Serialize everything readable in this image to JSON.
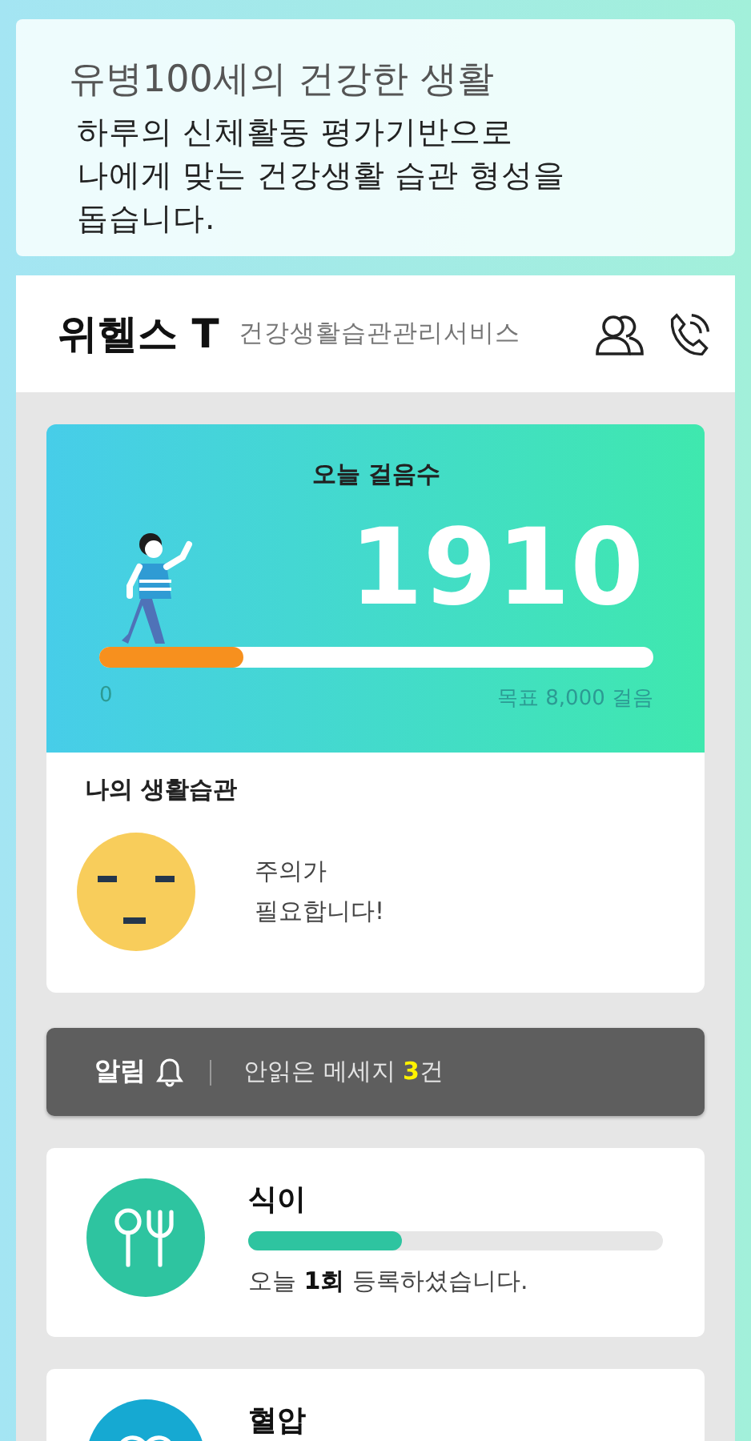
{
  "intro": {
    "title": "유병100세의 건강한 생활",
    "lines": [
      "하루의 신체활동 평가기반으로",
      "나에게 맞는 건강생활 습관 형성을",
      "돕습니다."
    ]
  },
  "header": {
    "title": "위헬스 T",
    "subtitle": "건강생활습관관리서비스"
  },
  "steps": {
    "label": "오늘 걸음수",
    "count": "1910",
    "level": 0.26,
    "min_label": "0",
    "goal_label": "목표 8,000 걸음"
  },
  "my_habit": {
    "title": "나의 생활습관",
    "message_lines": [
      "주의가",
      "필요합니다!"
    ]
  },
  "alert": {
    "label": "알림",
    "message": "안읽은 메세지",
    "count": "3",
    "unit": "건"
  },
  "habits": [
    {
      "kind": "meal",
      "color": "#2ec4a0",
      "title": "식이",
      "level": 0.37,
      "message": "오늘 **1회** 등록하셨습니다."
    },
    {
      "kind": "blood-pressure",
      "color": "#16a9d2",
      "title": "혈압"
    }
  ]
}
